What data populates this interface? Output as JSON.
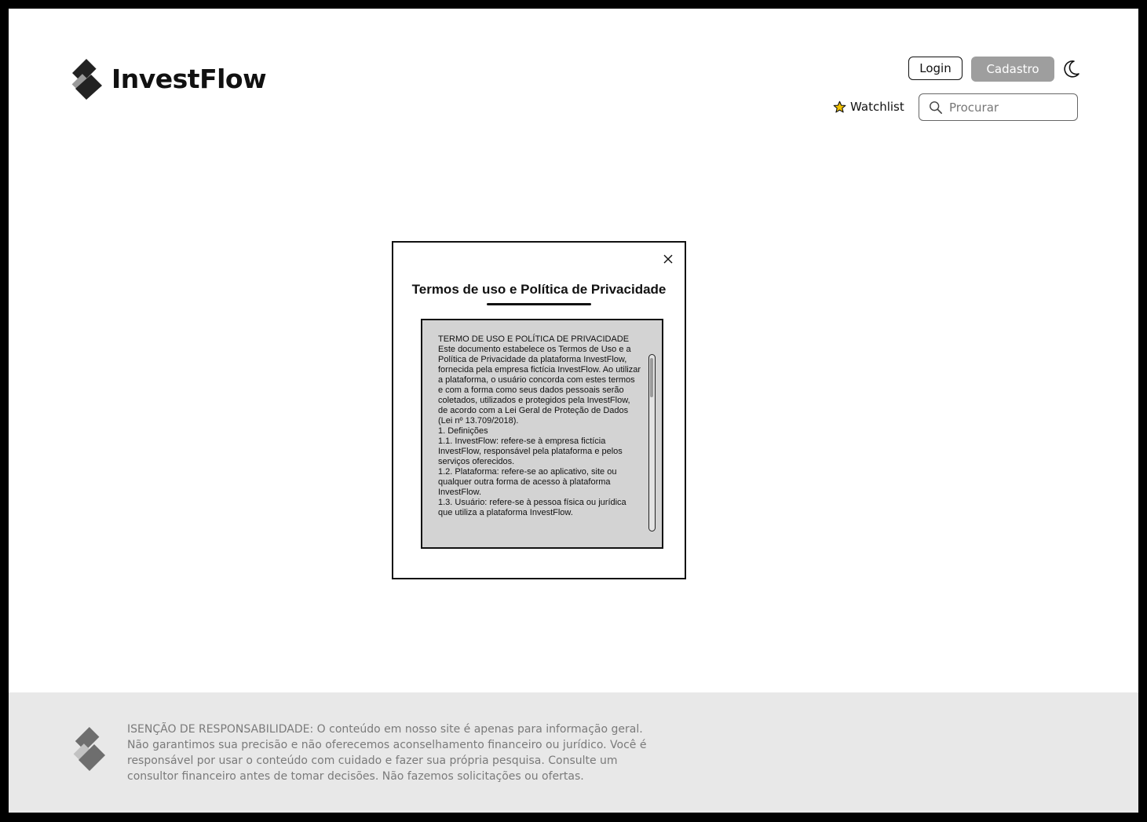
{
  "header": {
    "brand": "InvestFlow",
    "login_label": "Login",
    "signup_label": "Cadastro",
    "watchlist_label": "Watchlist",
    "search_placeholder": "Procurar"
  },
  "modal": {
    "title": "Termos de uso e Política de Privacidade",
    "terms_text": "TERMO DE USO E POLÍTICA DE PRIVACIDADE\nEste documento estabelece os Termos de Uso e a Política de Privacidade da plataforma InvestFlow, fornecida pela empresa fictícia InvestFlow. Ao utilizar a plataforma, o usuário concorda com estes termos e com a forma como seus dados pessoais serão coletados, utilizados e protegidos pela InvestFlow, de acordo com a Lei Geral de Proteção de Dados (Lei nº 13.709/2018).\n 1. Definições\n1.1. InvestFlow: refere-se à empresa fictícia InvestFlow, responsável pela plataforma e pelos serviços oferecidos.\n1.2. Plataforma: refere-se ao aplicativo, site ou qualquer outra forma de acesso à plataforma InvestFlow.\n1.3. Usuário: refere-se à pessoa física ou jurídica que utiliza a plataforma InvestFlow."
  },
  "footer": {
    "disclaimer": "ISENÇÃO DE RESPONSABILIDADE: O conteúdo em nosso site é apenas para informação geral. Não garantimos sua precisão e não oferecemos aconselhamento financeiro ou jurídico. Você é responsável por usar o conteúdo com cuidado e fazer sua própria pesquisa. Consulte um consultor financeiro antes de tomar decisões. Não fazemos solicitações ou ofertas."
  },
  "colors": {
    "signup_button": "#9e9e9e",
    "footer_background": "#e8e8e8",
    "terms_background": "#d3d3d3",
    "star": "#f2c200"
  },
  "icons": {
    "brand": "investflow-logo-icon",
    "theme": "moon-icon",
    "watchlist": "star-icon",
    "search": "search-icon",
    "close": "close-icon"
  }
}
